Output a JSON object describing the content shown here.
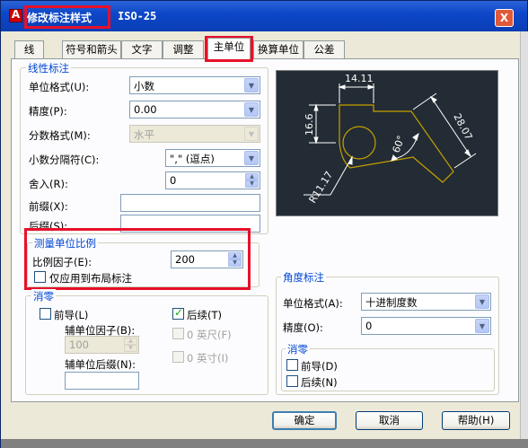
{
  "window": {
    "title": "修改标注样式",
    "style_name": "ISO-25",
    "close_glyph": "X",
    "icon_glyph": "A"
  },
  "tabs": [
    {
      "label": "线"
    },
    {
      "label": "符号和箭头"
    },
    {
      "label": "文字"
    },
    {
      "label": "调整"
    },
    {
      "label": "主单位",
      "active": true
    },
    {
      "label": "换算单位"
    },
    {
      "label": "公差"
    }
  ],
  "linear": {
    "legend": "线性标注",
    "unit_format_label": "单位格式(U):",
    "unit_format_value": "小数",
    "precision_label": "精度(P):",
    "precision_value": "0.00",
    "fraction_format_label": "分数格式(M):",
    "fraction_format_value": "水平",
    "decimal_sep_label": "小数分隔符(C):",
    "decimal_sep_value": "\",\" (逗点)",
    "round_off_label": "舍入(R):",
    "round_off_value": "0",
    "prefix_label": "前缀(X):",
    "prefix_value": "",
    "suffix_label": "后缀(S):",
    "suffix_value": ""
  },
  "scale": {
    "legend": "测量单位比例",
    "factor_label": "比例因子(E):",
    "factor_value": "200",
    "layout_only_label": "仅应用到布局标注",
    "layout_only_checked": false
  },
  "zero_linear": {
    "legend": "消零",
    "leading_label": "前导(L)",
    "leading_checked": false,
    "trailing_label": "后续(T)",
    "trailing_checked": true,
    "sub_factor_label": "辅单位因子(B):",
    "sub_factor_value": "100",
    "sub_suffix_label": "辅单位后缀(N):",
    "sub_suffix_value": "",
    "feet_label": "0 英尺(F)",
    "inches_label": "0 英寸(I)"
  },
  "preview": {
    "dim_top": "14.11",
    "dim_left": "16.6",
    "dim_right": "28.07",
    "dim_angle": "60°",
    "dim_radius": "R11.17"
  },
  "angular": {
    "legend": "角度标注",
    "unit_format_label": "单位格式(A):",
    "unit_format_value": "十进制度数",
    "precision_label": "精度(O):",
    "precision_value": "0",
    "zero_legend": "消零",
    "leading_label": "前导(D)",
    "leading_checked": false,
    "trailing_label": "后续(N)",
    "trailing_checked": false
  },
  "buttons": {
    "ok": "确定",
    "cancel": "取消",
    "help": "帮助(H)"
  }
}
